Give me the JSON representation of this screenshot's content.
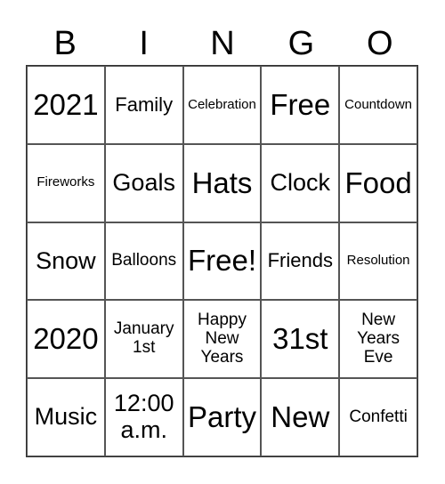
{
  "header": [
    "B",
    "I",
    "N",
    "G",
    "O"
  ],
  "cells": [
    {
      "text": "2021",
      "size": "s5"
    },
    {
      "text": "Family",
      "size": "s3"
    },
    {
      "text": "Celebration",
      "size": "s1"
    },
    {
      "text": "Free",
      "size": "s5"
    },
    {
      "text": "Countdown",
      "size": "s1"
    },
    {
      "text": "Fireworks",
      "size": "s1"
    },
    {
      "text": "Goals",
      "size": "s4"
    },
    {
      "text": "Hats",
      "size": "s5"
    },
    {
      "text": "Clock",
      "size": "s4"
    },
    {
      "text": "Food",
      "size": "s5"
    },
    {
      "text": "Snow",
      "size": "s4"
    },
    {
      "text": "Balloons",
      "size": "s2"
    },
    {
      "text": "Free!",
      "size": "s5"
    },
    {
      "text": "Friends",
      "size": "s3"
    },
    {
      "text": "Resolution",
      "size": "s1"
    },
    {
      "text": "2020",
      "size": "s5"
    },
    {
      "text": "January 1st",
      "size": "s2"
    },
    {
      "text": "Happy New Years",
      "size": "s2"
    },
    {
      "text": "31st",
      "size": "s5"
    },
    {
      "text": "New Years Eve",
      "size": "s2"
    },
    {
      "text": "Music",
      "size": "s4"
    },
    {
      "text": "12:00 a.m.",
      "size": "s4"
    },
    {
      "text": "Party",
      "size": "s5"
    },
    {
      "text": "New",
      "size": "s5"
    },
    {
      "text": "Confetti",
      "size": "s2"
    }
  ]
}
